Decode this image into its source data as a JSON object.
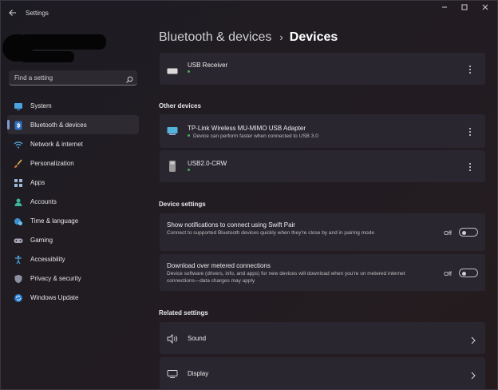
{
  "window": {
    "title": "Settings"
  },
  "search": {
    "placeholder": "Find a setting"
  },
  "sidebar": {
    "items": [
      {
        "label": "System",
        "icon": "monitor-icon"
      },
      {
        "label": "Bluetooth & devices",
        "icon": "bluetooth-icon",
        "active": true
      },
      {
        "label": "Network & internet",
        "icon": "wifi-icon"
      },
      {
        "label": "Personalization",
        "icon": "brush-icon"
      },
      {
        "label": "Apps",
        "icon": "apps-icon"
      },
      {
        "label": "Accounts",
        "icon": "person-icon"
      },
      {
        "label": "Time & language",
        "icon": "globe-clock-icon"
      },
      {
        "label": "Gaming",
        "icon": "gamepad-icon"
      },
      {
        "label": "Accessibility",
        "icon": "accessibility-icon"
      },
      {
        "label": "Privacy & security",
        "icon": "shield-icon"
      },
      {
        "label": "Windows Update",
        "icon": "update-icon"
      }
    ]
  },
  "breadcrumb": {
    "parent": "Bluetooth & devices",
    "separator": "›",
    "current": "Devices"
  },
  "devices_top": [
    {
      "name": "USB Receiver",
      "icon": "keyboard-icon"
    }
  ],
  "other_devices": {
    "heading": "Other devices",
    "items": [
      {
        "name": "TP-Link Wireless MU-MIMO USB Adapter",
        "status": "Device can perform faster when connected to USB 3.0",
        "icon": "network-adapter-icon"
      },
      {
        "name": "USB2.0-CRW",
        "status": "",
        "icon": "usb-drive-icon"
      }
    ]
  },
  "device_settings": {
    "heading": "Device settings",
    "items": [
      {
        "title": "Show notifications to connect using Swift Pair",
        "desc": "Connect to supported Bluetooth devices quickly when they're close by and in pairing mode",
        "state": "Off"
      },
      {
        "title": "Download over metered connections",
        "desc": "Device software (drivers, info, and apps) for new devices will download when you're on metered internet connections—data charges may apply",
        "state": "Off"
      }
    ]
  },
  "related_settings": {
    "heading": "Related settings",
    "items": [
      {
        "label": "Sound",
        "icon": "speaker-icon"
      },
      {
        "label": "Display",
        "icon": "display-icon"
      }
    ]
  },
  "colors": {
    "accent": "#7e9bd6",
    "status_ok": "#4caf50",
    "card": "#2a2630"
  }
}
